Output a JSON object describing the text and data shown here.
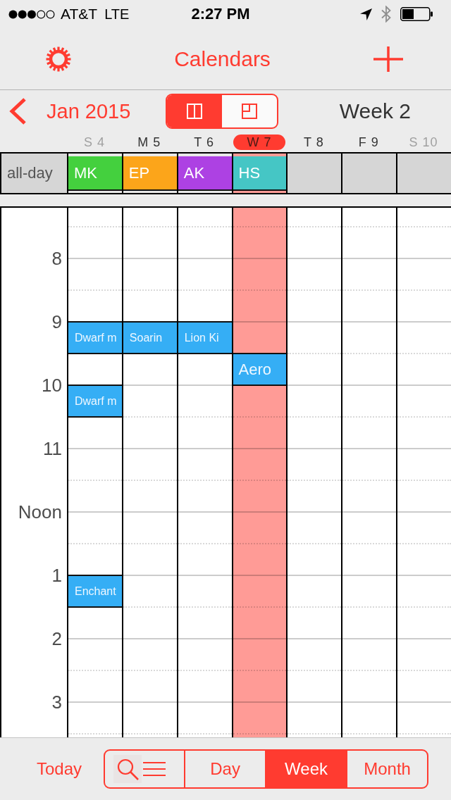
{
  "status_bar": {
    "carrier": "AT&T",
    "network": "LTE",
    "time": "2:27 PM"
  },
  "nav_bar": {
    "title": "Calendars"
  },
  "week_header": {
    "month": "Jan 2015",
    "view_toggle": [
      {
        "kind": "columns",
        "selected": true
      },
      {
        "kind": "quadrant",
        "selected": false
      }
    ],
    "week": "Week 2"
  },
  "all_day_label": "all-day",
  "days": [
    {
      "label": "S 4",
      "weekend": true,
      "selected": false,
      "all_day": {
        "title": "MK",
        "color": "#44d03e"
      }
    },
    {
      "label": "M 5",
      "weekend": false,
      "selected": false,
      "all_day": {
        "title": "EP",
        "color": "#fca51a"
      }
    },
    {
      "label": "T 6",
      "weekend": false,
      "selected": false,
      "all_day": {
        "title": "AK",
        "color": "#ad41e3"
      }
    },
    {
      "label": "W 7",
      "weekend": false,
      "selected": true,
      "all_day": {
        "title": "HS",
        "color": "#45c6c5"
      }
    },
    {
      "label": "T 8",
      "weekend": false,
      "selected": false
    },
    {
      "label": "F 9",
      "weekend": false,
      "selected": false
    },
    {
      "label": "S 10",
      "weekend": true,
      "selected": false
    }
  ],
  "hours": [
    {
      "label": "8"
    },
    {
      "label": "9",
      "days": [
        {
          "first_half": {
            "title": "Dwarf m"
          }
        },
        {
          "first_half": {
            "title": "Soarin"
          }
        },
        {
          "first_half": {
            "title": "Lion Ki"
          }
        },
        {
          "second_half": {
            "title": "Aero"
          }
        }
      ]
    },
    {
      "label": "10",
      "days": [
        {
          "first_half": {
            "title": "Dwarf m"
          }
        }
      ]
    },
    {
      "label": "11"
    },
    {
      "label": "Noon"
    },
    {
      "label": "1",
      "days": [
        {
          "first_half": {
            "title": "Enchant"
          }
        }
      ]
    },
    {
      "label": "2"
    },
    {
      "label": "3"
    }
  ],
  "toolbar": {
    "today": "Today",
    "views": [
      {
        "kind": "search",
        "selected": false
      },
      {
        "kind": "text",
        "label": "Day",
        "selected": false
      },
      {
        "kind": "text",
        "label": "Week",
        "selected": true
      },
      {
        "kind": "text",
        "label": "Month",
        "selected": false
      }
    ]
  }
}
